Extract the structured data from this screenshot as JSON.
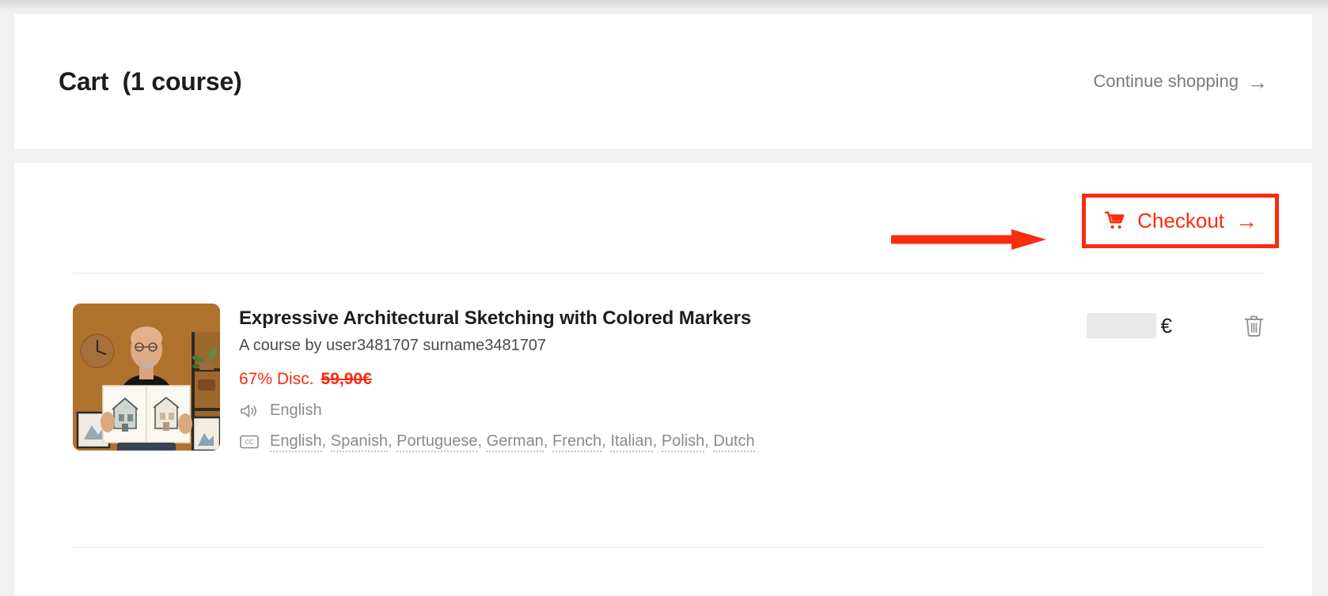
{
  "header": {
    "title": "Cart  (1 course)",
    "continue_shopping_label": "Continue shopping",
    "arrow_glyph": "→"
  },
  "checkout": {
    "label": "Checkout",
    "arrow_glyph": "→",
    "accent_color": "#f92c0f",
    "highlight_border_color": "#f92c0f"
  },
  "annotation": {
    "arrow_color": "#f92c0f"
  },
  "cart_item": {
    "title": "Expressive Architectural Sketching with Colored Markers",
    "author": "A course by user3481707 surname3481707",
    "discount_label": "67% Disc.",
    "original_price": "59,90€",
    "audio_language": "English",
    "subtitle_languages": [
      "English",
      "Spanish",
      "Portuguese",
      "German",
      "French",
      "Italian",
      "Polish",
      "Dutch"
    ],
    "price_value": "",
    "price_currency": "€",
    "thumbnail_alt": "Instructor holding an open sketchbook with two architectural marker sketches"
  },
  "colors": {
    "page_background": "#f1f1f1",
    "card_background": "#ffffff",
    "text_primary": "#1d1d1b",
    "text_muted": "#8a8a8a",
    "divider": "#e8e8e8",
    "redacted_box": "#e9e9e9"
  }
}
